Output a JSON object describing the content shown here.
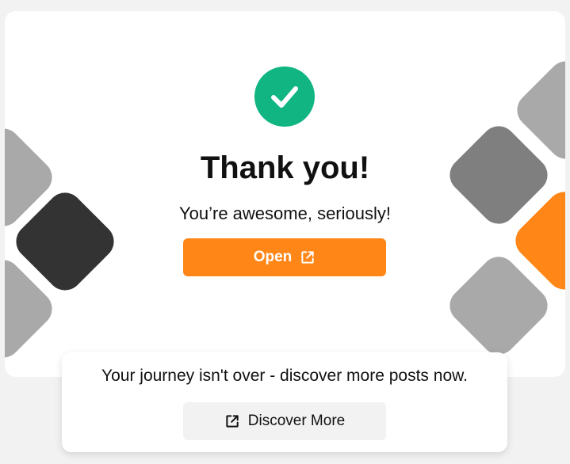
{
  "colors": {
    "accent_orange": "#ff8617",
    "success_green": "#10b582",
    "gray_light": "#a9a9a9",
    "gray_mid": "#7f7f7f",
    "gray_dark": "#333333"
  },
  "icons": {
    "success": "check-circle-icon",
    "external": "external-link-icon"
  },
  "main": {
    "title": "Thank you!",
    "subtitle": "You’re awesome, seriously!",
    "open_label": "Open"
  },
  "footer": {
    "message": "Your journey isn't over - discover more posts now.",
    "discover_label": "Discover More"
  }
}
